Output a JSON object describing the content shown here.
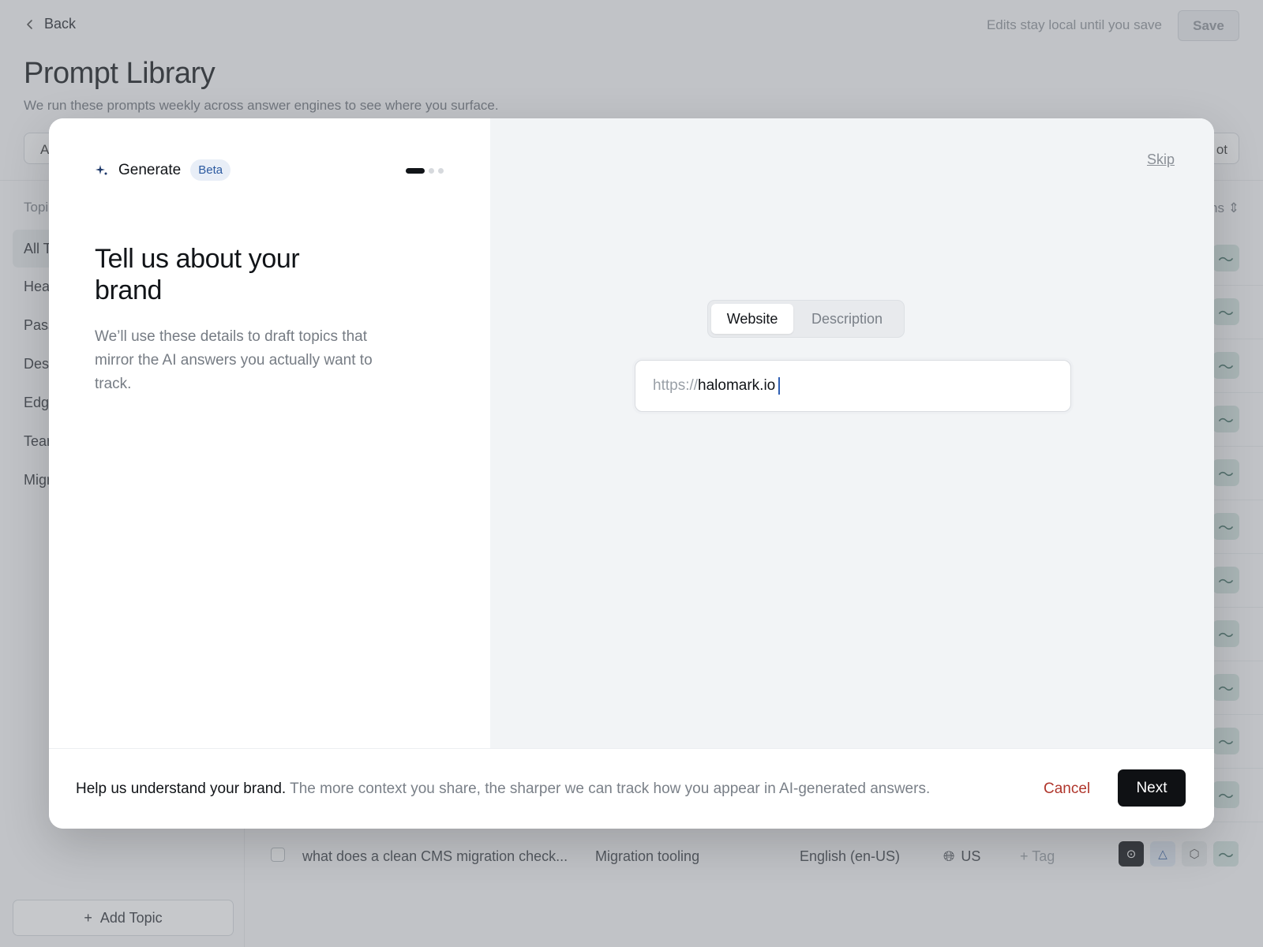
{
  "header": {
    "back_label": "Back",
    "note": "Edits stay local until you save",
    "save_label": "Save"
  },
  "page": {
    "title": "Prompt Library",
    "subtitle": "We run these prompts weekly across answer engines to see where you surface.",
    "filter_pill_fragment": "A",
    "right_pill_fragment": "ot"
  },
  "sidebar": {
    "heading_fragment": "Topi",
    "items": [
      {
        "label": "All T"
      },
      {
        "label": "Hea"
      },
      {
        "label": "Pass"
      },
      {
        "label": "Des"
      },
      {
        "label": "Edg"
      },
      {
        "label": "Tear"
      },
      {
        "label": "Migr"
      }
    ],
    "add_topic_label": "Add Topic"
  },
  "table": {
    "sort_fragment": "ns",
    "trend_glyph": "〜",
    "visible_row": {
      "prompt": "what does a clean CMS migration check...",
      "topic": "Migration tooling",
      "language": "English (en-US)",
      "region": "US",
      "tag": "+ Tag"
    }
  },
  "modal": {
    "generate_label": "Generate",
    "beta_label": "Beta",
    "headline": "Tell us about your brand",
    "description": "We’ll use these details to draft topics that mirror the AI answers you actually want to track.",
    "skip_label": "Skip",
    "tabs": [
      {
        "label": "Website",
        "active": true
      },
      {
        "label": "Description",
        "active": false
      }
    ],
    "url_prefix": "https://",
    "url_value": "halomark.io",
    "footer_strong": "Help us understand your brand.",
    "footer_text": "The more context you share, the sharper we can track how you appear in AI-generated answers.",
    "cancel_label": "Cancel",
    "next_label": "Next",
    "progress": {
      "current_step": 1,
      "total_steps": 3
    }
  },
  "colors": {
    "accent_dark": "#0f1114",
    "cancel_red": "#b0362c",
    "beta_blue": "#2c5aa0",
    "trend_green": "#3c6a60"
  }
}
